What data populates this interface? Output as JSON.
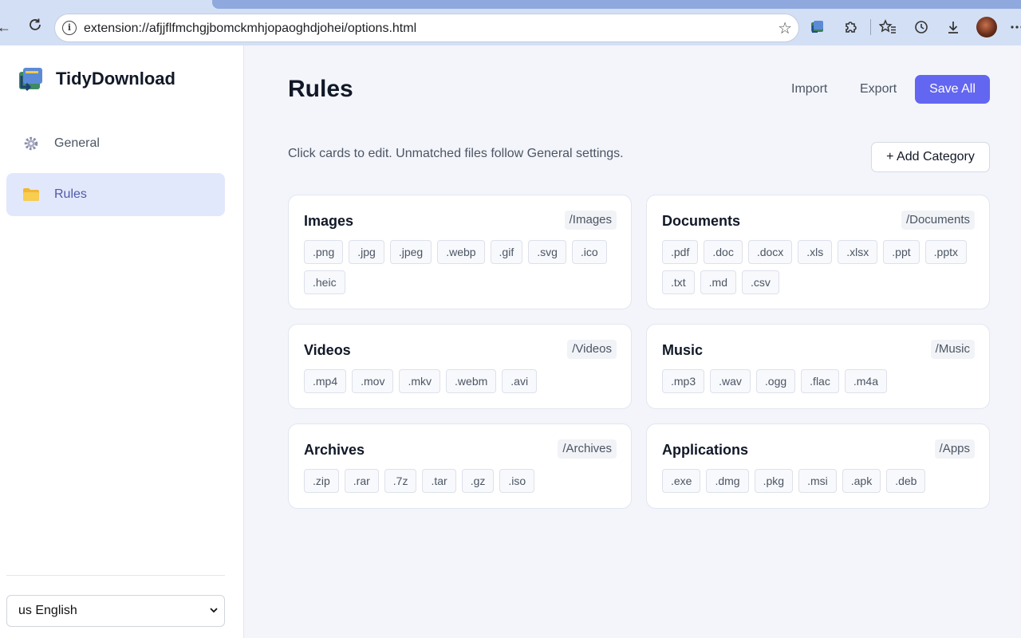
{
  "browser": {
    "url": "extension://afjjflfmchgjbomckmhjopaoghdjohei/options.html"
  },
  "sidebar": {
    "brand": "TidyDownload",
    "items": [
      {
        "label": "General",
        "icon": "gear-icon"
      },
      {
        "label": "Rules",
        "icon": "folder-icon",
        "active": true
      }
    ],
    "language": "us English"
  },
  "main": {
    "title": "Rules",
    "import_label": "Import",
    "export_label": "Export",
    "save_label": "Save All",
    "hint": "Click cards to edit. Unmatched files follow General settings.",
    "add_label": "+ Add Category",
    "categories": [
      {
        "name": "Images",
        "path": "/Images",
        "extensions": [
          ".png",
          ".jpg",
          ".jpeg",
          ".webp",
          ".gif",
          ".svg",
          ".ico",
          ".heic"
        ]
      },
      {
        "name": "Documents",
        "path": "/Documents",
        "extensions": [
          ".pdf",
          ".doc",
          ".docx",
          ".xls",
          ".xlsx",
          ".ppt",
          ".pptx",
          ".txt",
          ".md",
          ".csv"
        ]
      },
      {
        "name": "Videos",
        "path": "/Videos",
        "extensions": [
          ".mp4",
          ".mov",
          ".mkv",
          ".webm",
          ".avi"
        ]
      },
      {
        "name": "Music",
        "path": "/Music",
        "extensions": [
          ".mp3",
          ".wav",
          ".ogg",
          ".flac",
          ".m4a"
        ]
      },
      {
        "name": "Archives",
        "path": "/Archives",
        "extensions": [
          ".zip",
          ".rar",
          ".7z",
          ".tar",
          ".gz",
          ".iso"
        ]
      },
      {
        "name": "Applications",
        "path": "/Apps",
        "extensions": [
          ".exe",
          ".dmg",
          ".pkg",
          ".msi",
          ".apk",
          ".deb"
        ]
      }
    ]
  },
  "colors": {
    "accent": "#6366f1",
    "active_nav_bg": "#e2e8fb",
    "page_bg": "#f3f5fb"
  }
}
